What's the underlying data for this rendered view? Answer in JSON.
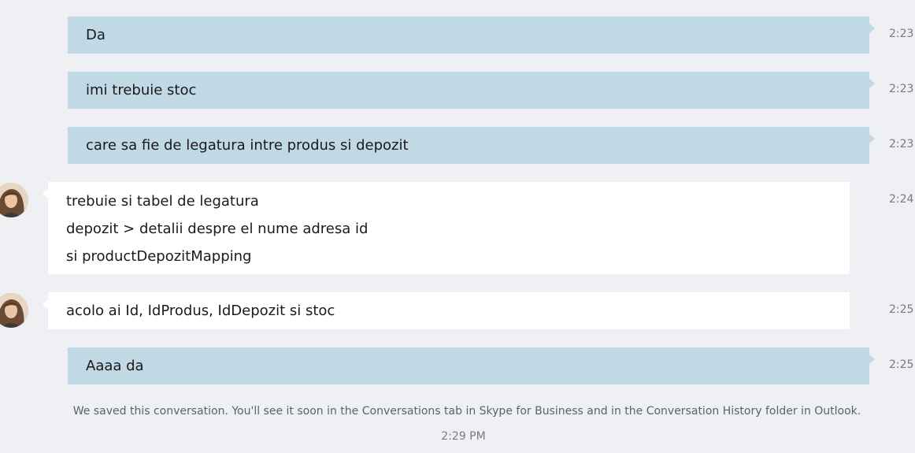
{
  "messages": [
    {
      "direction": "out",
      "lines": [
        "Da"
      ],
      "time": "2:23"
    },
    {
      "direction": "out",
      "lines": [
        "imi trebuie stoc"
      ],
      "time": "2:23"
    },
    {
      "direction": "out",
      "lines": [
        "care sa fie de legatura intre produs si depozit"
      ],
      "time": "2:23"
    },
    {
      "direction": "in",
      "lines": [
        "trebuie si tabel de legatura",
        "depozit > detalii despre el nume adresa id",
        "si productDepozitMapping"
      ],
      "time": "2:24"
    },
    {
      "direction": "in",
      "lines": [
        "acolo ai Id, IdProdus, IdDepozit si stoc"
      ],
      "time": "2:25"
    },
    {
      "direction": "out",
      "lines": [
        "Aaaa da"
      ],
      "time": "2:25"
    }
  ],
  "notice": "We saved this conversation. You'll see it soon in the Conversations tab in Skype for Business and in the Conversation History folder in Outlook.",
  "footer_time": "2:29 PM",
  "colors": {
    "background": "#eff0f4",
    "outgoing_bubble": "#c1d8e5",
    "incoming_bubble": "#ffffff"
  }
}
